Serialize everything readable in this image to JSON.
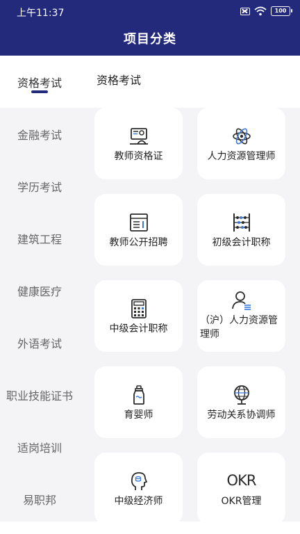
{
  "status_bar": {
    "time": "上午11:37",
    "battery": "100"
  },
  "header": {
    "title": "项目分类"
  },
  "sidebar": {
    "items": [
      {
        "label": "资格考试",
        "active": true
      },
      {
        "label": "金融考试"
      },
      {
        "label": "学历考试"
      },
      {
        "label": "建筑工程"
      },
      {
        "label": "健康医疗"
      },
      {
        "label": "外语考试"
      },
      {
        "label": "职业技能证书"
      },
      {
        "label": "适岗培训"
      },
      {
        "label": "易职邦"
      }
    ]
  },
  "main": {
    "section_title": "资格考试",
    "cards": [
      {
        "label": "教师资格证",
        "icon": "teacher-certificate-icon"
      },
      {
        "label": "人力资源管理师",
        "icon": "atom-icon"
      },
      {
        "label": "教师公开招聘",
        "icon": "document-grid-icon"
      },
      {
        "label": "初级会计职称",
        "icon": "abacus-icon"
      },
      {
        "label": "中级会计职称",
        "icon": "calculator-icon"
      },
      {
        "label": "（沪）人力资源管理师",
        "icon": "person-list-icon"
      },
      {
        "label": "育婴师",
        "icon": "baby-bottle-icon"
      },
      {
        "label": "劳动关系协调师",
        "icon": "globe-icon"
      },
      {
        "label": "中级经济师",
        "icon": "head-coin-icon"
      },
      {
        "label": "OKR管理",
        "icon": "okr-icon",
        "icon_text": "OKR"
      }
    ]
  }
}
